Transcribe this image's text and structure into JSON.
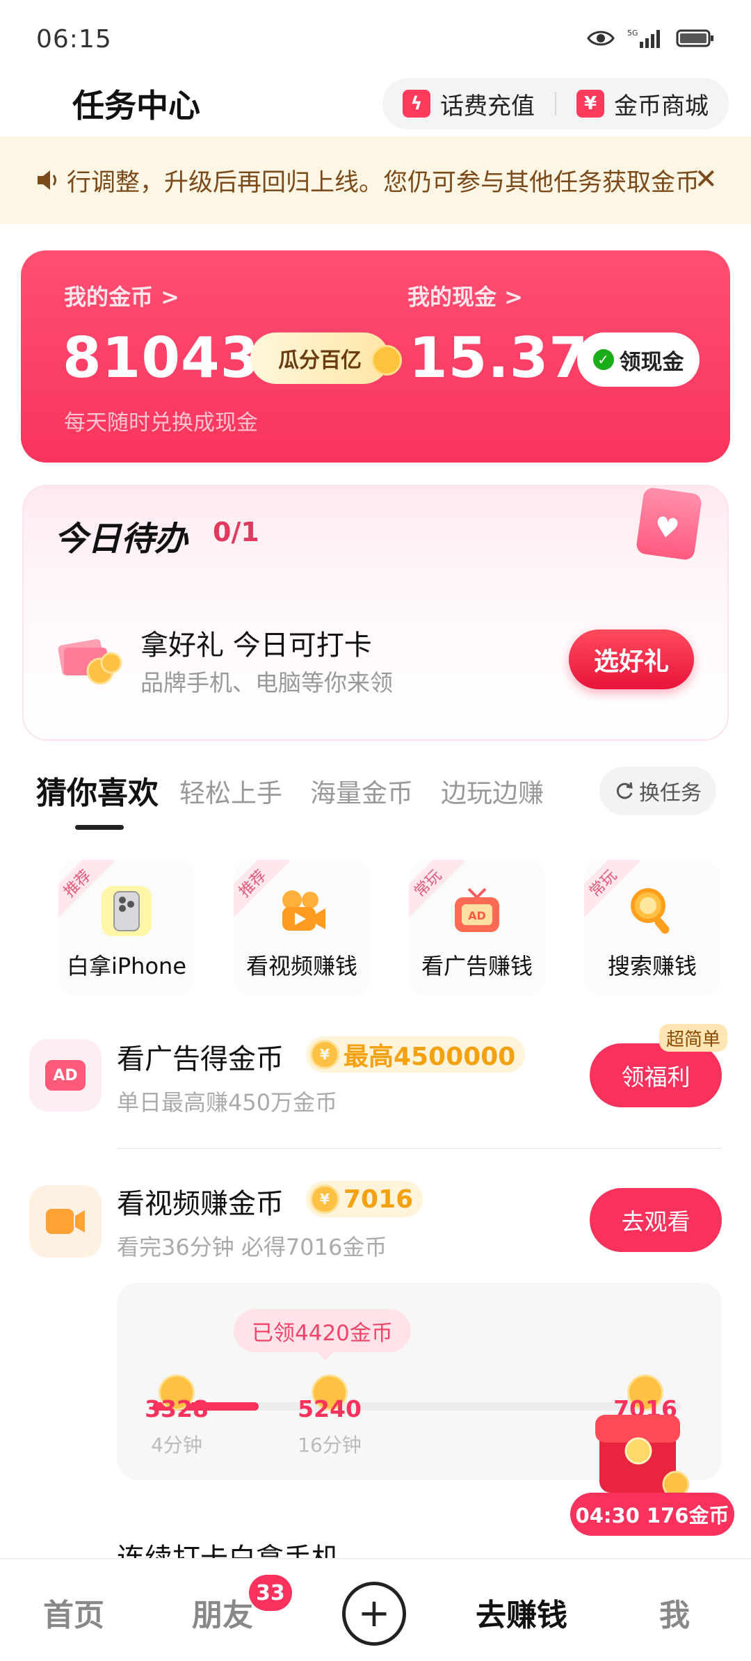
{
  "status_bar": {
    "time": "06:15",
    "network": "5G"
  },
  "header": {
    "title": "任务中心",
    "recharge_label": "话费充值",
    "mall_label": "金币商城"
  },
  "notice": {
    "text": "行调整，升级后再回归上线。您仍可参与其他任务获取金币"
  },
  "balance": {
    "coins_label": "我的金币 >",
    "coins_value": "81043",
    "split_button": "瓜分百亿",
    "cash_label": "我的现金 >",
    "cash_value": "15.37",
    "cash_button": "领现金",
    "subtitle": "每天随时兑换成现金"
  },
  "today": {
    "title": "今日待办",
    "count": "0/1",
    "gift_title": "拿好礼 今日可打卡",
    "gift_subtitle": "品牌手机、电脑等你来领",
    "gift_button": "选好礼"
  },
  "tabs": {
    "items": [
      "猜你喜欢",
      "轻松上手",
      "海量金币",
      "边玩边赚"
    ],
    "active": "猜你喜欢",
    "swap_label": "换任务"
  },
  "categories": [
    {
      "tag": "推荐",
      "label": "白拿iPhone",
      "icon": "iphone-icon"
    },
    {
      "tag": "推荐",
      "label": "看视频赚钱",
      "icon": "video-camera-icon"
    },
    {
      "tag": "常玩",
      "label": "看广告赚钱",
      "icon": "ad-tv-icon"
    },
    {
      "tag": "常玩",
      "label": "搜索赚钱",
      "icon": "search-icon"
    }
  ],
  "tasks": [
    {
      "title": "看广告得金币",
      "reward": "最高4500000",
      "subtitle": "单日最高赚450万金币",
      "button": "领福利",
      "tag": "超简单",
      "icon_text": "AD"
    },
    {
      "title": "看视频赚金币",
      "reward": "7016",
      "subtitle": "看完36分钟 必得7016金币",
      "button": "去观看"
    }
  ],
  "progress": {
    "tip": "已领4420金币",
    "fill_fraction": 0.2,
    "nodes": [
      {
        "value": "3328",
        "time": "4分钟"
      },
      {
        "value": "5240",
        "time": "16分钟"
      },
      {
        "value": "7016",
        "time": ""
      }
    ]
  },
  "floating": {
    "label": "04:30 176金币"
  },
  "next_task": {
    "title": "连续打卡白拿手机"
  },
  "nav": {
    "home": "首页",
    "friends": "朋友",
    "friends_badge": "33",
    "earn": "去赚钱",
    "me": "我"
  },
  "colors": {
    "accent": "#f8325c",
    "coin": "#ffc043",
    "notice_bg": "#fdf6e4"
  }
}
